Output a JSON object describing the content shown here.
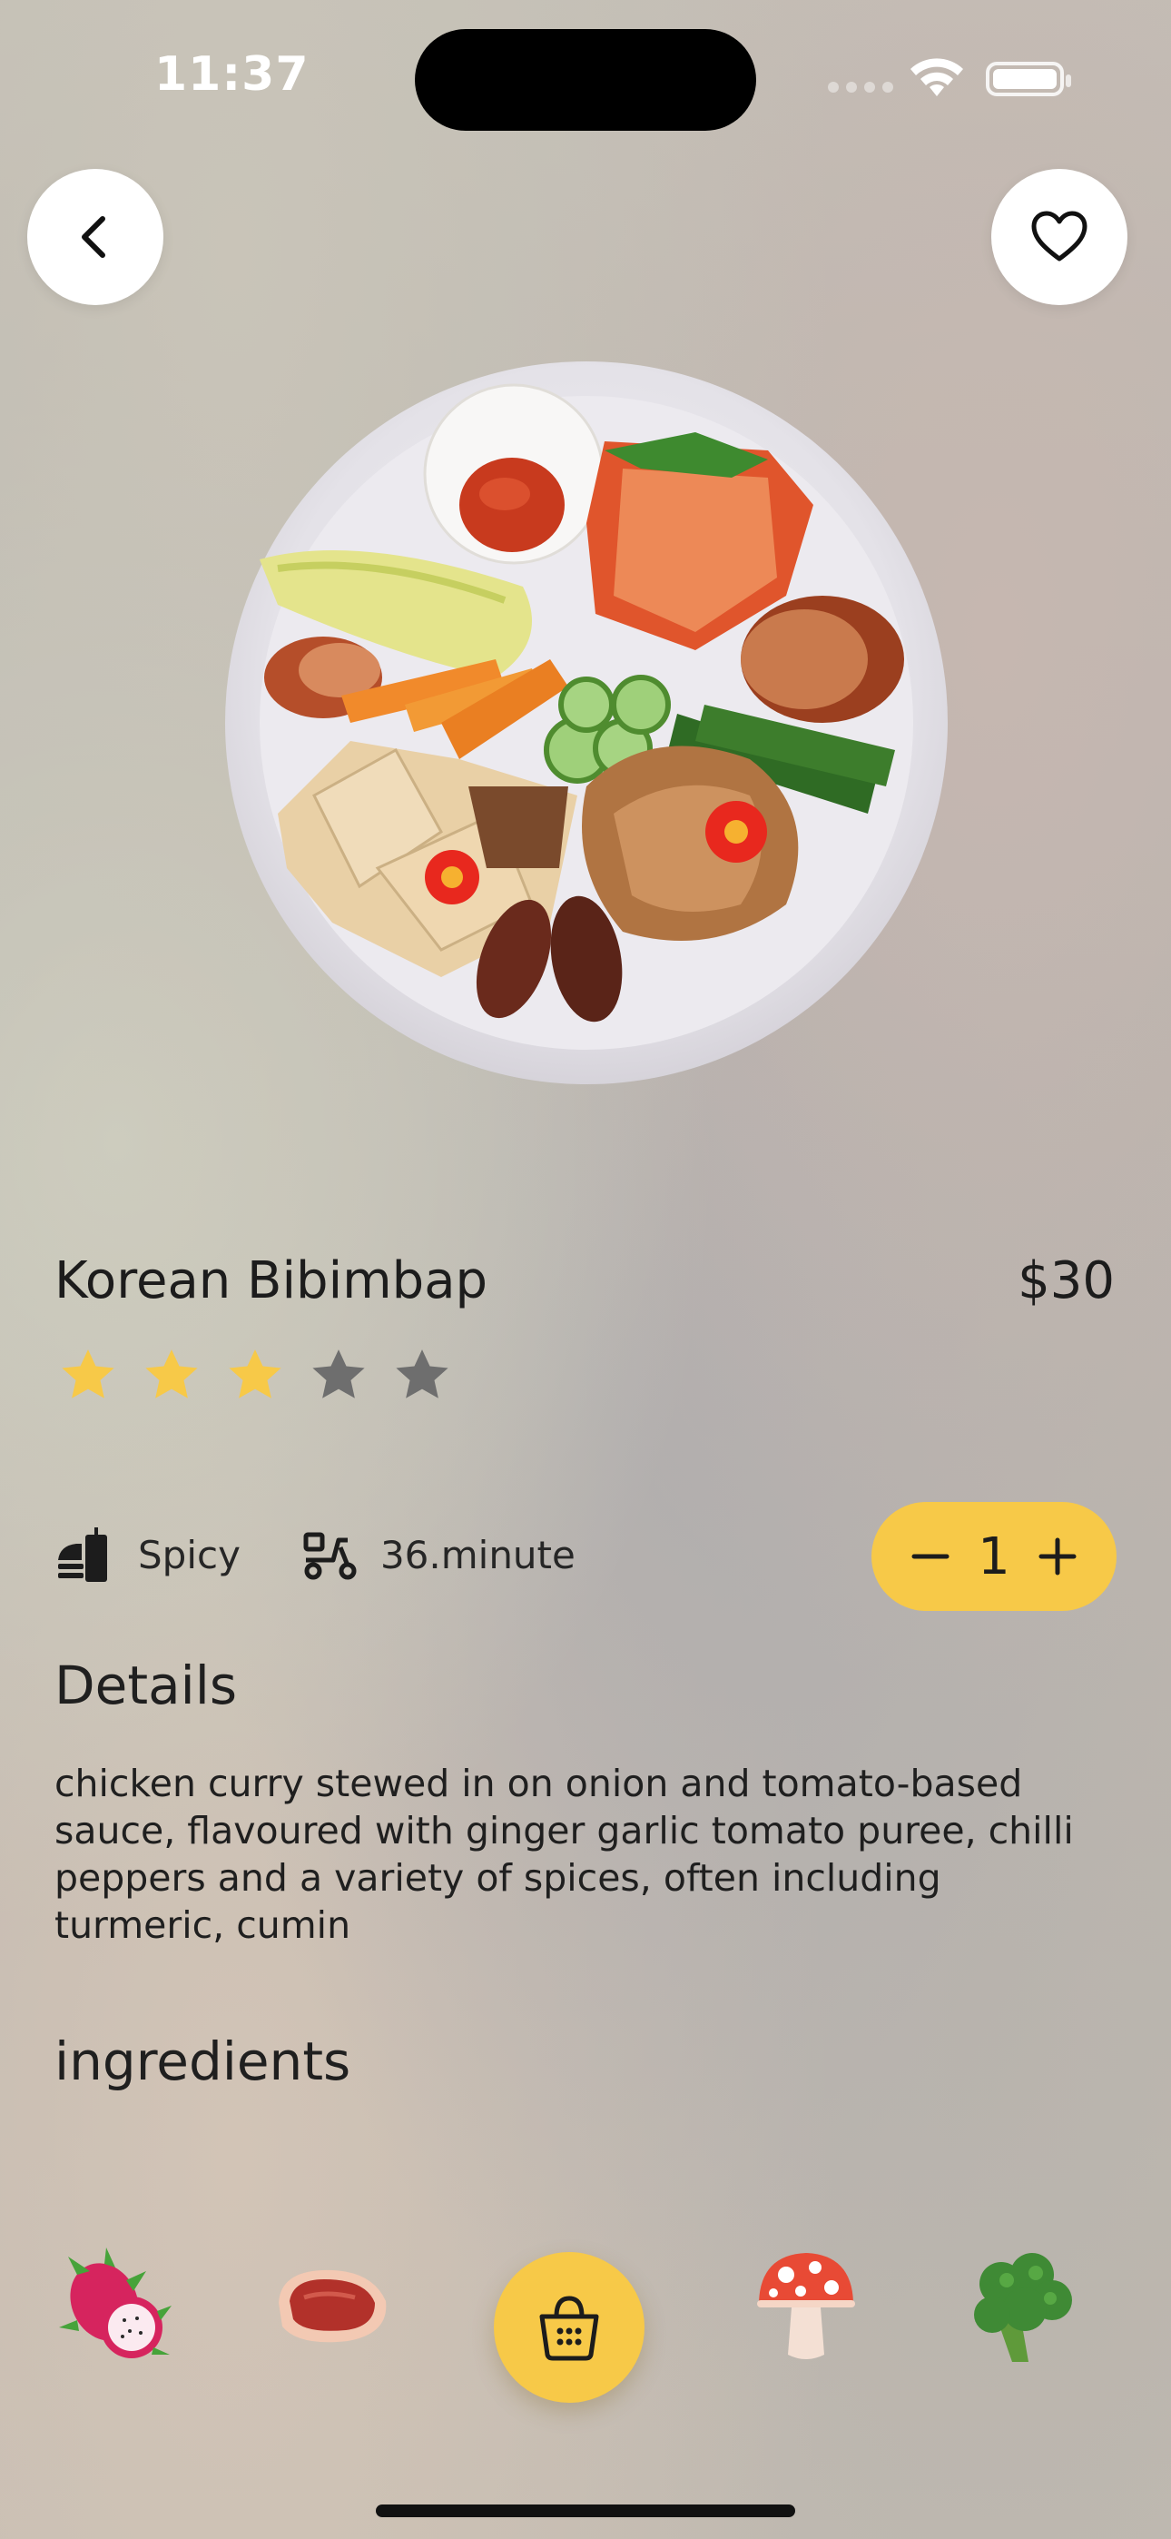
{
  "status_bar": {
    "time": "11:37"
  },
  "header": {
    "back_icon": "chevron-left-icon",
    "favorite_icon": "heart-outline-icon"
  },
  "dish": {
    "name": "Korean Bibimbap",
    "price": "$30",
    "rating": 3,
    "rating_max": 5,
    "heat_label": "Spicy",
    "delivery_time": "36.minute",
    "quantity": "1"
  },
  "details": {
    "title": "Details",
    "text": "chicken curry stewed in on onion and tomato-based sauce, flavoured with ginger garlic tomato puree, chilli peppers and a variety of spices, often including turmeric, cumin"
  },
  "ingredients": {
    "title": "ingredients",
    "items": [
      "dragon-fruit-icon",
      "steak-icon",
      "mushroom-icon",
      "broccoli-icon"
    ]
  },
  "colors": {
    "accent": "#F7C948",
    "star_on": "#F7C948",
    "star_off": "#6E6E6E"
  }
}
